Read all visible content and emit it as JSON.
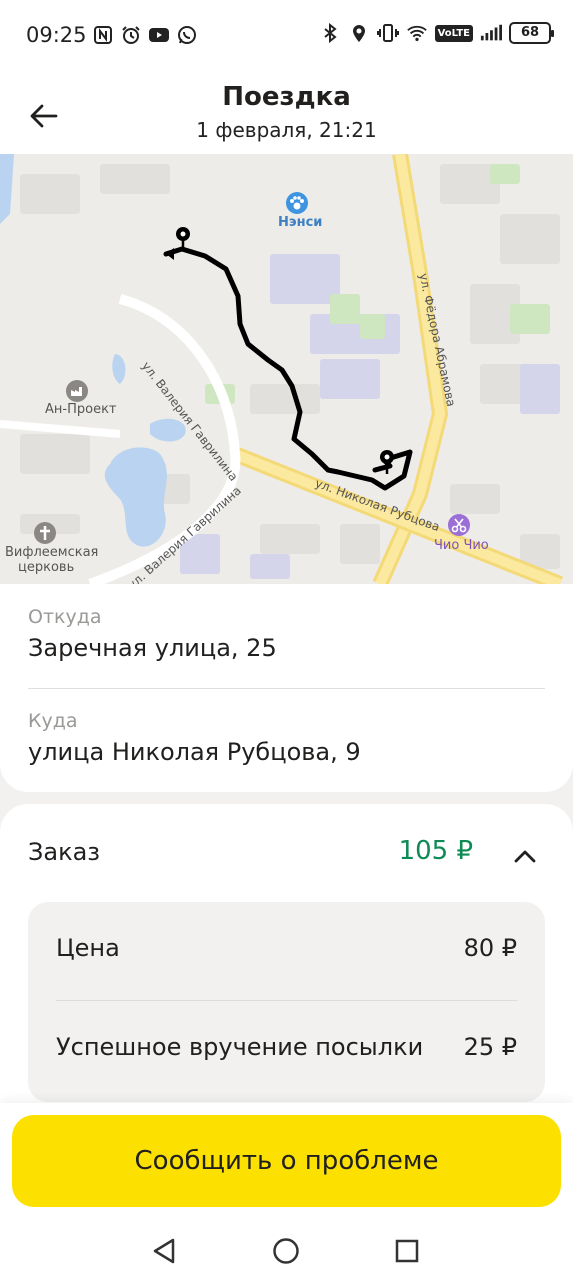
{
  "status_bar": {
    "time": "09:25",
    "left_icons": [
      "nfc-icon",
      "alarm-icon",
      "youtube-icon",
      "whatsapp-icon"
    ],
    "right_icons": [
      "bluetooth-icon",
      "location-icon",
      "vibrate-icon",
      "wifi-icon",
      "volte-icon",
      "signal-icon",
      "battery-icon"
    ],
    "volte": "VoLTE",
    "battery": "68"
  },
  "header": {
    "title": "Поездка",
    "subtitle": "1 февраля, 21:21"
  },
  "map": {
    "labels": {
      "nensi": "Нэнси",
      "an_proekt": "Ан-Проект",
      "church_line1": "Вифлеемская",
      "church_line2": "церковь",
      "chio_chio": "Чио Чио",
      "street_gavrilina_1": "ул. Валерия Гаврилина",
      "street_gavrilina_2": "ул. Валерия Гаврилина",
      "street_abramova": "ул. Фёдора Абрамова",
      "street_rubtsova": "ул. Николая Рубцова"
    }
  },
  "route": {
    "from_label": "Откуда",
    "from_value": "Заречная улица, 25",
    "to_label": "Куда",
    "to_value": "улица Николая Рубцова, 9"
  },
  "order": {
    "title": "Заказ",
    "total": "105 ₽",
    "items": [
      {
        "label": "Цена",
        "value": "80 ₽"
      },
      {
        "label": "Успешное вручение посылки",
        "value": "25 ₽"
      }
    ]
  },
  "actions": {
    "report_problem": "Сообщить о проблеме"
  },
  "colors": {
    "accent_yellow": "#fce000",
    "price_green": "#0e8a55"
  }
}
